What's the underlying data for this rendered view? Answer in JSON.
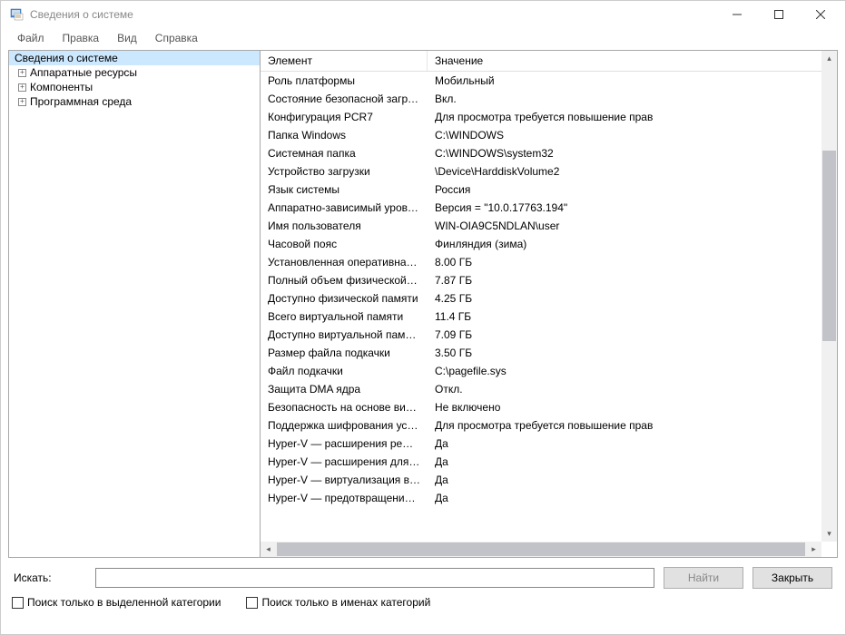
{
  "window": {
    "title": "Сведения о системе"
  },
  "menu": {
    "file": "Файл",
    "edit": "Правка",
    "view": "Вид",
    "help": "Справка"
  },
  "tree": {
    "root": "Сведения о системе",
    "children": [
      {
        "label": "Аппаратные ресурсы"
      },
      {
        "label": "Компоненты"
      },
      {
        "label": "Программная среда"
      }
    ]
  },
  "list": {
    "header_element": "Элемент",
    "header_value": "Значение",
    "rows": [
      {
        "element": "Роль платформы",
        "value": "Мобильный"
      },
      {
        "element": "Состояние безопасной загруз...",
        "value": "Вкл."
      },
      {
        "element": "Конфигурация PCR7",
        "value": "Для просмотра требуется повышение прав"
      },
      {
        "element": "Папка Windows",
        "value": "C:\\WINDOWS"
      },
      {
        "element": "Системная папка",
        "value": "C:\\WINDOWS\\system32"
      },
      {
        "element": "Устройство загрузки",
        "value": "\\Device\\HarddiskVolume2"
      },
      {
        "element": "Язык системы",
        "value": "Россия"
      },
      {
        "element": "Аппаратно-зависимый уровен...",
        "value": "Версия = \"10.0.17763.194\""
      },
      {
        "element": "Имя пользователя",
        "value": "WIN-OIA9C5NDLAN\\user"
      },
      {
        "element": "Часовой пояс",
        "value": "Финляндия (зима)"
      },
      {
        "element": "Установленная оперативная п...",
        "value": "8.00 ГБ"
      },
      {
        "element": "Полный объем физической па...",
        "value": "7.87 ГБ"
      },
      {
        "element": "Доступно физической памяти",
        "value": "4.25 ГБ"
      },
      {
        "element": "Всего виртуальной памяти",
        "value": "11.4 ГБ"
      },
      {
        "element": "Доступно виртуальной памяти",
        "value": "7.09 ГБ"
      },
      {
        "element": "Размер файла подкачки",
        "value": "3.50 ГБ"
      },
      {
        "element": "Файл подкачки",
        "value": "C:\\pagefile.sys"
      },
      {
        "element": "Защита DMA ядра",
        "value": "Откл."
      },
      {
        "element": "Безопасность на основе вирту...",
        "value": "Не включено"
      },
      {
        "element": "Поддержка шифрования устр...",
        "value": "Для просмотра требуется повышение прав"
      },
      {
        "element": "Hyper-V — расширения режи...",
        "value": "Да"
      },
      {
        "element": "Hyper-V — расширения для п...",
        "value": "Да"
      },
      {
        "element": "Hyper-V — виртуализация вкл...",
        "value": "Да"
      },
      {
        "element": "Hyper-V — предотвращение в...",
        "value": "Да"
      }
    ]
  },
  "search": {
    "label": "Искать:",
    "find_btn": "Найти",
    "close_btn": "Закрыть",
    "opt_selected_category": "Поиск только в выделенной категории",
    "opt_category_names": "Поиск только в именах категорий"
  }
}
